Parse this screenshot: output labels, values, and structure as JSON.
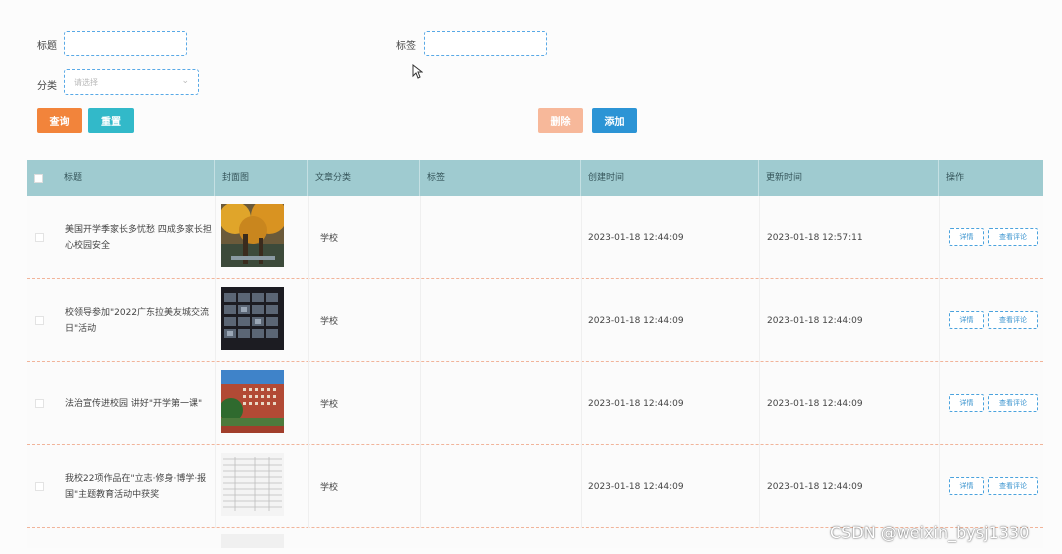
{
  "filters": {
    "title_label": "标题",
    "tag_label": "标签",
    "category_label": "分类",
    "category_placeholder": "请选择",
    "title_value": "",
    "tag_value": ""
  },
  "buttons": {
    "query": "查询",
    "reset": "重置",
    "delete": "删除",
    "add": "添加"
  },
  "table": {
    "headers": [
      "标题",
      "封面图",
      "文章分类",
      "标签",
      "创建时间",
      "更新时间",
      "操作"
    ],
    "rows": [
      {
        "title": "美国开学季家长多忧愁 四成多家长担心校园安全",
        "category": "学校",
        "tag": "",
        "created": "2023-01-18 12:44:09",
        "updated": "2023-01-18 12:57:11",
        "thumb": "autumn-trees-icon"
      },
      {
        "title": "校领导参加\"2022广东拉美友城交流日\"活动",
        "category": "学校",
        "tag": "",
        "created": "2023-01-18 12:44:09",
        "updated": "2023-01-18 12:44:09",
        "thumb": "video-grid-icon"
      },
      {
        "title": "法治宣传进校园 讲好\"开学第一课\"",
        "category": "学校",
        "tag": "",
        "created": "2023-01-18 12:44:09",
        "updated": "2023-01-18 12:44:09",
        "thumb": "campus-building-icon"
      },
      {
        "title": "我校22项作品在\"立志·修身·博学·报国\"主题教育活动中获奖",
        "category": "学校",
        "tag": "",
        "created": "2023-01-18 12:44:09",
        "updated": "2023-01-18 12:44:09",
        "thumb": "document-table-icon"
      }
    ],
    "action_detail": "详情",
    "action_comments": "查看评论"
  },
  "watermark": "CSDN @weixin_bysj1330",
  "colors": {
    "query": "#f2843b",
    "reset": "#32b9c9",
    "delete": "#f7b89a",
    "add": "#2c94d5",
    "header_bg": "#9fcbd0"
  }
}
